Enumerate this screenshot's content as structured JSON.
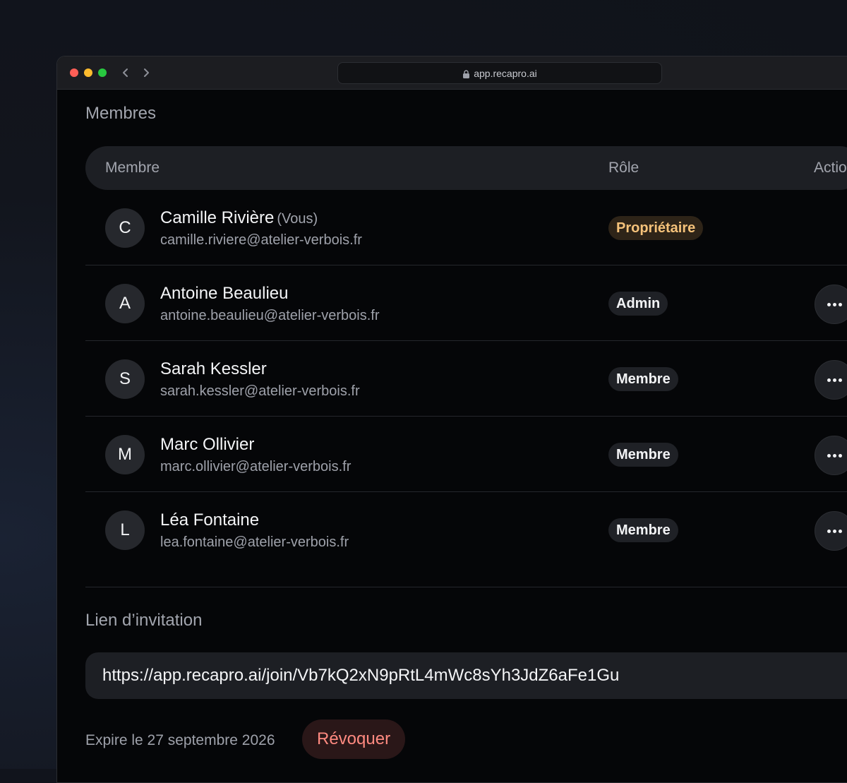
{
  "browser": {
    "url": "app.recapro.ai"
  },
  "members_section": {
    "title": "Membres",
    "columns": {
      "member": "Membre",
      "role": "Rôle",
      "actions": "Actions"
    },
    "rows": [
      {
        "initial": "C",
        "name": "Camille Rivière",
        "you_tag": "(Vous)",
        "email": "camille.riviere@atelier-verbois.fr",
        "role": "Propriétaire",
        "has_actions": false
      },
      {
        "initial": "A",
        "name": "Antoine Beaulieu",
        "you_tag": "",
        "email": "antoine.beaulieu@atelier-verbois.fr",
        "role": "Admin",
        "has_actions": true
      },
      {
        "initial": "S",
        "name": "Sarah Kessler",
        "you_tag": "",
        "email": "sarah.kessler@atelier-verbois.fr",
        "role": "Membre",
        "has_actions": true
      },
      {
        "initial": "M",
        "name": "Marc Ollivier",
        "you_tag": "",
        "email": "marc.ollivier@atelier-verbois.fr",
        "role": "Membre",
        "has_actions": true
      },
      {
        "initial": "L",
        "name": "Léa Fontaine",
        "you_tag": "",
        "email": "lea.fontaine@atelier-verbois.fr",
        "role": "Membre",
        "has_actions": true
      }
    ]
  },
  "invite_section": {
    "title": "Lien d’invitation",
    "link": "https://app.recapro.ai/join/Vb7kQ2xN9pRtL4mWc8sYh3JdZ6aFe1Gu",
    "expires": "Expire le 27 septembre 2026",
    "revoke_label": "Révoquer"
  },
  "icons": {
    "window_controls": [
      "close-icon",
      "minimize-icon",
      "zoom-icon"
    ],
    "nav": [
      "chevron-left-icon",
      "chevron-right-icon"
    ],
    "url": "lock-icon",
    "row_action": "more-horizontal-icon"
  },
  "colors": {
    "owner_badge_text": "#f5c27a",
    "revoke_text": "#ff8a80"
  }
}
